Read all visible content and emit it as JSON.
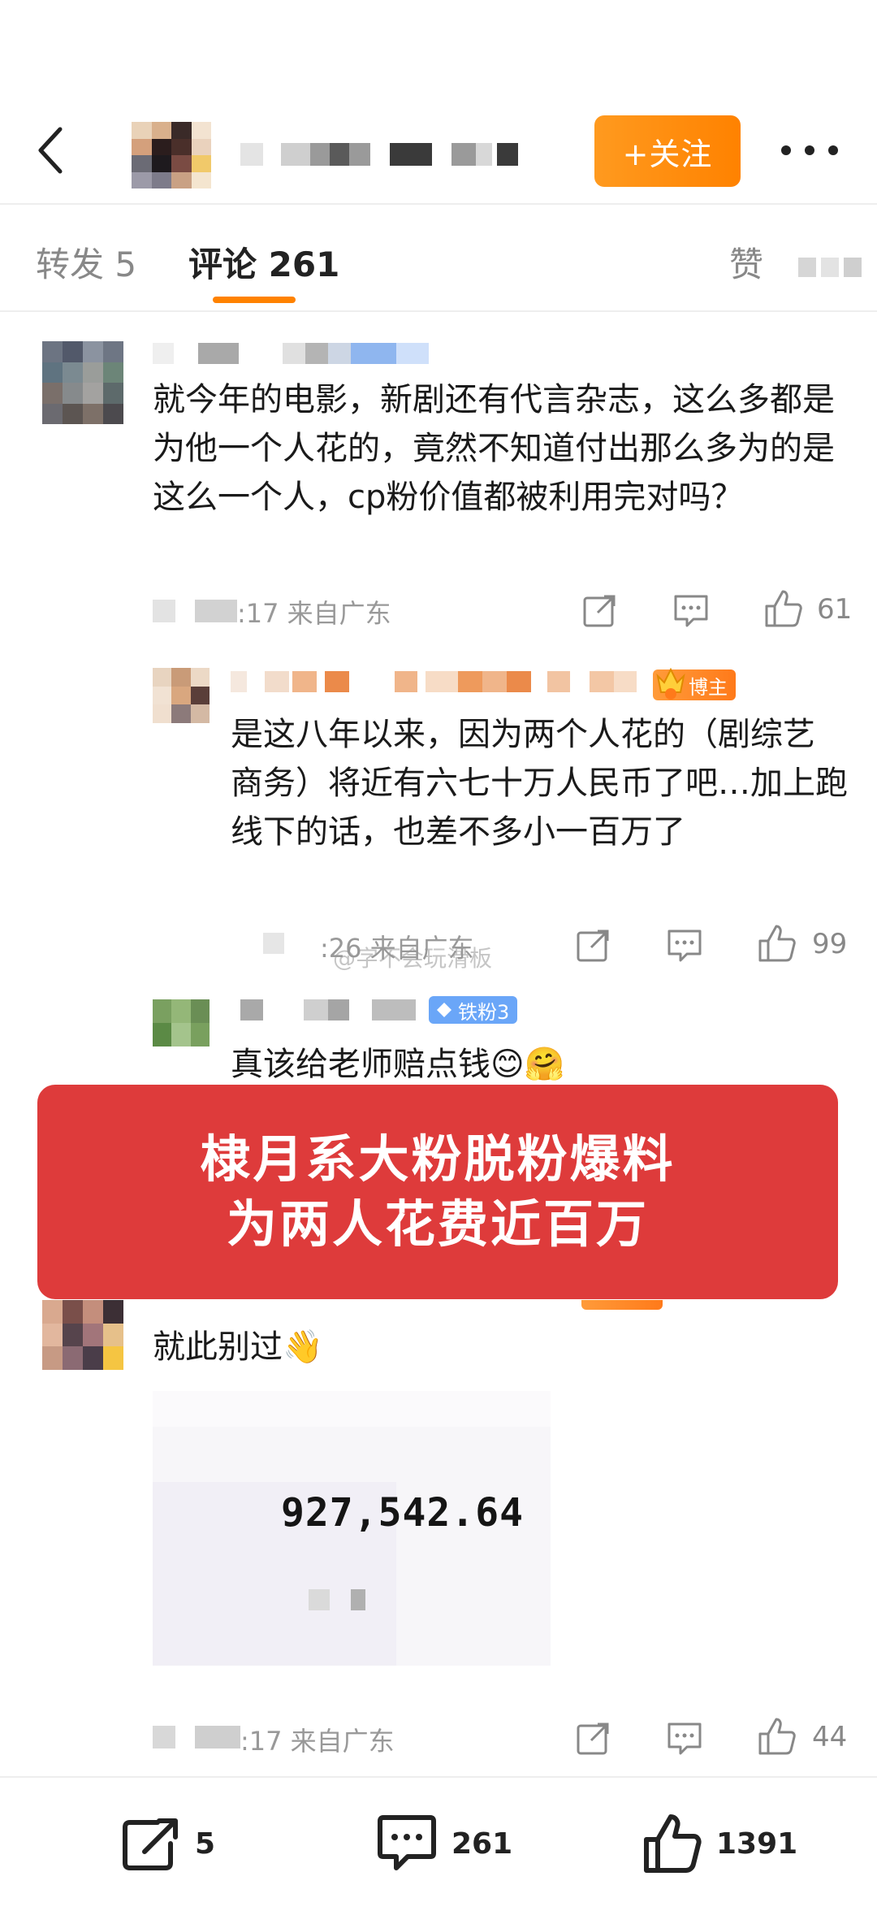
{
  "header": {
    "follow_label": "+关注"
  },
  "tabs": {
    "repost": "转发 5",
    "comments": "评论 261",
    "likes": "赞"
  },
  "comments": [
    {
      "text": "就今年的电影，新剧还有代言杂志，这么多都是为他一个人花的，竟然不知道付出那么多为的是这么一个人，cp粉价值都被利用完对吗？",
      "time_location": ":17 来自广东",
      "likes": "61"
    },
    {
      "badge": "博主",
      "text": "是这八年以来，因为两个人花的（剧综艺 商务）将近有六七十万人民币了吧…加上跑线下的话，也差不多小一百万了",
      "time_location": ":26 来自广东",
      "likes": "99"
    },
    {
      "badge": "铁粉3",
      "text": "真该给老师赔点钱😊🤗"
    },
    {
      "text": "就此别过👋",
      "image_amount": "927,542.64",
      "time_location": ":17 来自广东",
      "likes": "44"
    }
  ],
  "watermark": "@字不会玩滑板",
  "banner": {
    "line1": "棣月系大粉脱粉爆料",
    "line2": "为两人花费近百万"
  },
  "bottom_bar": {
    "reposts": "5",
    "comments": "261",
    "likes": "1391"
  },
  "colors": {
    "accent": "#ff8200",
    "banner_red": "#de3b3b",
    "iron_fan_blue": "#6aa6f8"
  }
}
